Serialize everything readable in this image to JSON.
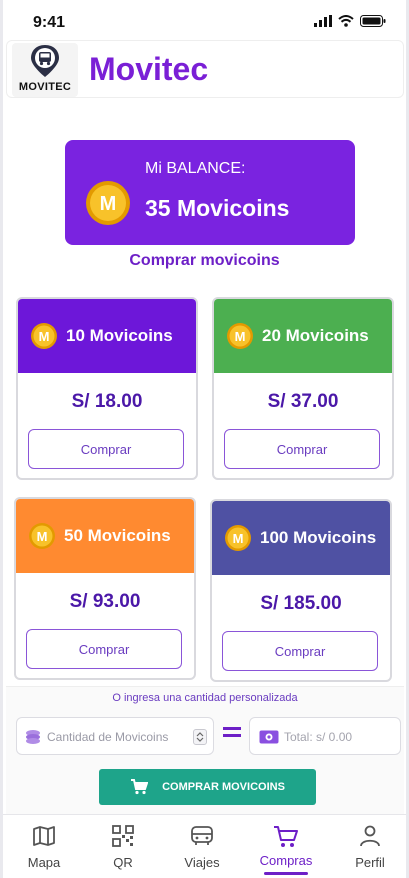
{
  "status_bar": {
    "time": "9:41"
  },
  "header": {
    "logo_text": "MOVITEC",
    "title": "Movitec"
  },
  "balance": {
    "label": "Mi BALANCE:",
    "amount": "35 Movicoins"
  },
  "buy_link": "Comprar movicoins",
  "coin_symbol": "M",
  "packages": [
    {
      "name": "10 Movicoins",
      "price": "S/ 18.00",
      "button": "Comprar",
      "color": "#6d17d9"
    },
    {
      "name": "20 Movicoins",
      "price": "S/ 37.00",
      "button": "Comprar",
      "color": "#4caf50"
    },
    {
      "name": "50 Movicoins",
      "price": "S/ 93.00",
      "button": "Comprar",
      "color": "#ff8a30"
    },
    {
      "name": "100 Movicoins",
      "price": "S/ 185.00",
      "button": "Comprar",
      "color": "#4f51a3"
    }
  ],
  "custom": {
    "label": "O ingresa una cantidad personalizada",
    "quantity_placeholder": "Cantidad de Movicoins",
    "total_placeholder": "Total: s/ 0.00",
    "buy_button": "COMPRAR MOVICOINS"
  },
  "nav": [
    {
      "label": "Mapa",
      "icon": "map-icon"
    },
    {
      "label": "QR",
      "icon": "qr-code-icon"
    },
    {
      "label": "Viajes",
      "icon": "bus-icon"
    },
    {
      "label": "Compras",
      "icon": "cart-icon",
      "active": true
    },
    {
      "label": "Perfil",
      "icon": "user-icon"
    }
  ],
  "colors": {
    "brand": "#7a1fd6",
    "balance_card": "#7a23e0",
    "primary_action": "#1ea48a",
    "coin": "#f5b800"
  }
}
